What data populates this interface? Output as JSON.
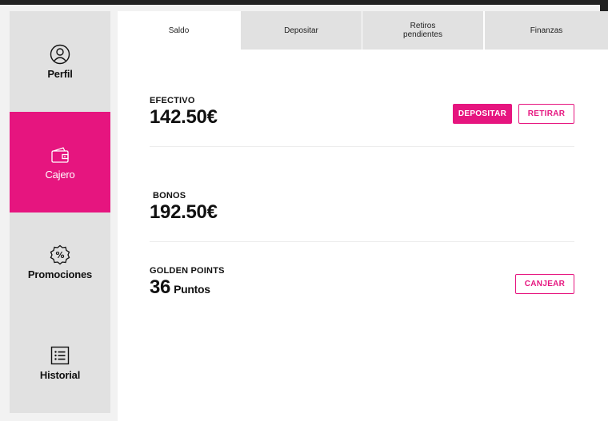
{
  "sidebar": {
    "items": [
      {
        "label": "Perfil",
        "icon": "user-circle-icon"
      },
      {
        "label": "Cajero",
        "icon": "wallet-icon",
        "active": true
      },
      {
        "label": "Promociones",
        "icon": "percent-badge-icon"
      },
      {
        "label": "Historial",
        "icon": "list-icon"
      }
    ]
  },
  "tabs": [
    {
      "label": "Saldo",
      "active": true
    },
    {
      "label": "Depositar"
    },
    {
      "label": "Retiros pendientes"
    },
    {
      "label": "Finanzas"
    }
  ],
  "balance": {
    "cash": {
      "label": "EFECTIVO",
      "value": "142.50€"
    },
    "bonus": {
      "label": "BONOS",
      "value": "192.50€"
    },
    "golden": {
      "label": "GOLDEN POINTS",
      "value": "36",
      "unit": "Puntos"
    }
  },
  "buttons": {
    "deposit": "DEPOSITAR",
    "withdraw": "RETIRAR",
    "redeem": "CANJEAR"
  },
  "colors": {
    "accent": "#e6157f",
    "sidebar_bg": "#e1e1e1"
  }
}
